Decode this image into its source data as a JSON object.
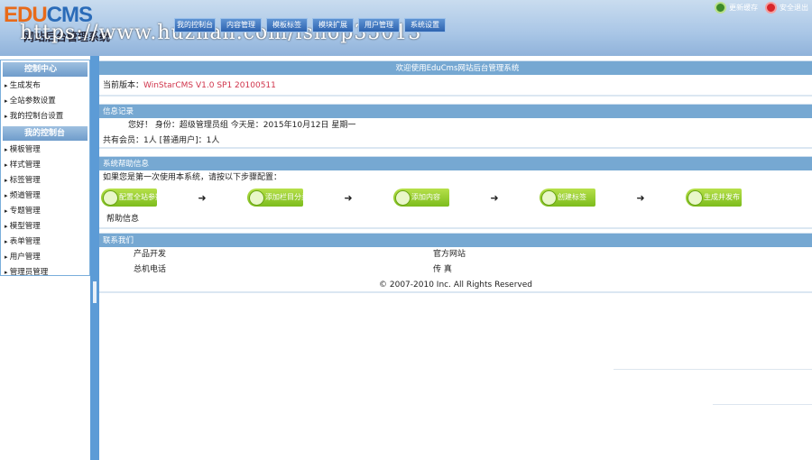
{
  "header": {
    "logo_a": "EDU",
    "logo_b": "CMS",
    "subtitle": "网站后台管理系统",
    "watermark": "https://www.huzhan.com/ishop35013",
    "nav": [
      "我的控制台",
      "内容管理",
      "模板标签",
      "模块扩展",
      "用户管理",
      "系统设置"
    ],
    "refresh": "更新缓存",
    "logout": "安全退出"
  },
  "sidebar": {
    "groups": [
      {
        "title": "控制中心",
        "items": [
          "生成发布",
          "全站参数设置",
          "我的控制台设置"
        ]
      },
      {
        "title": "我的控制台",
        "items": [
          "模板管理",
          "样式管理",
          "标签管理",
          "频道管理",
          "专题管理",
          "模型管理",
          "表单管理",
          "用户管理",
          "管理员管理"
        ]
      }
    ]
  },
  "main": {
    "welcome": "欢迎使用EduCms网站后台管理系统",
    "version_label": "当前版本：",
    "version": "WinStarCMS V1.0 SP1 20100511",
    "info_title": "信息记录",
    "greeting": "您好！ 身份：超级管理员组 今天是：2015年10月12日 星期一",
    "members": "共有会员：1人 [普通用户]：1人",
    "help_title": "系统帮助信息",
    "help_intro": "如果您是第一次使用本系统，请按以下步骤配置：",
    "steps": [
      "配置全站参数",
      "添加栏目分类",
      "添加内容",
      "创建标签",
      "生成并发布"
    ],
    "arrow": "➜",
    "help_info": "帮助信息",
    "contact_title": "联系我们",
    "contact": [
      [
        "产品开发",
        "官方网站"
      ],
      [
        "总机电话",
        "传 真"
      ]
    ],
    "copyright": "© 2007-2010 Inc. All Rights Reserved"
  },
  "colors": {
    "accent": "#76a8d2",
    "version": "#d0334a"
  }
}
